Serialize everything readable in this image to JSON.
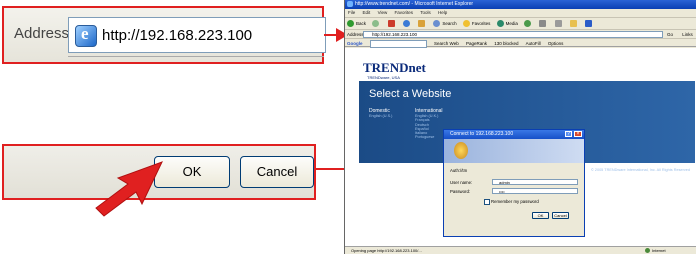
{
  "address_zoom": {
    "label": "Address",
    "url": "http://192.168.223.100"
  },
  "buttons_zoom": {
    "ok": "OK",
    "cancel": "Cancel"
  },
  "browser": {
    "title": "http://www.trendnet.com/ - Microsoft Internet Explorer",
    "menu": [
      "File",
      "Edit",
      "View",
      "Favorites",
      "Tools",
      "Help"
    ],
    "toolbar": [
      "Back",
      "Search",
      "Favorites",
      "Media"
    ],
    "address_label": "Address",
    "address_value": "http://192.168.223.100",
    "go_label": "Go",
    "links_label": "Links",
    "google_label": "Google",
    "google_items": [
      "Search Web",
      "PageRank",
      "130 blocked",
      "AutoFill",
      "Options"
    ],
    "status_text": "Opening page http://192.168.223.100/...",
    "status_zone": "Internet"
  },
  "website": {
    "logo": "TRENDnet",
    "logo_sub": "TRENDware, USA",
    "select_title": "Select a Website",
    "domestic": "Domestic",
    "domestic_sub": "English (U.S.)",
    "international": "International",
    "languages": [
      "English (U.K.)",
      "Français",
      "Deutsch",
      "Español",
      "Italiano",
      "Portuguese"
    ],
    "copyright": "© 2005 TRENDware International, Inc. All Rights Reserved"
  },
  "dialog": {
    "title": "Connect to 192.168.223.100",
    "realm": "Auth://tm",
    "user_label": "User name:",
    "user_value": "admin",
    "password_label": "Password:",
    "password_value": "••••",
    "remember_label": "Remember my password",
    "ok": "OK",
    "cancel": "Cancel"
  },
  "colors": {
    "arrow": "#e02020",
    "titlebar": "#0a3fb3",
    "band": "#1b4b86"
  }
}
